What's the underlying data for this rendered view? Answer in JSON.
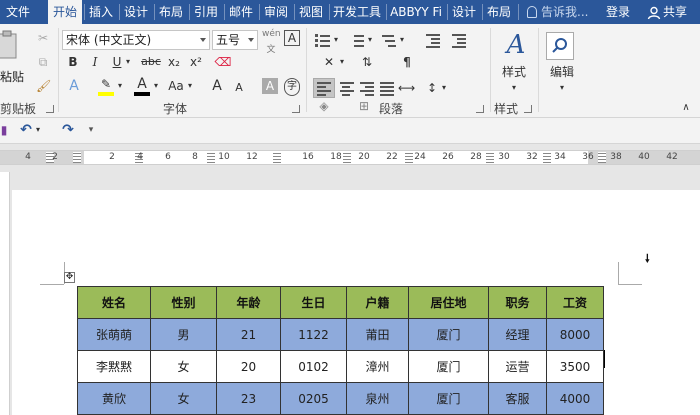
{
  "ribbon_tabs": [
    {
      "label": "文件",
      "active": false
    },
    {
      "label": "开始",
      "active": true
    },
    {
      "label": "插入",
      "active": false
    },
    {
      "label": "设计",
      "active": false
    },
    {
      "label": "布局",
      "active": false
    },
    {
      "label": "引用",
      "active": false
    },
    {
      "label": "邮件",
      "active": false
    },
    {
      "label": "审阅",
      "active": false
    },
    {
      "label": "视图",
      "active": false
    },
    {
      "label": "开发工具",
      "active": false
    },
    {
      "label": "ABBYY Fi",
      "active": false
    },
    {
      "label": "设计",
      "active": false
    },
    {
      "label": "布局",
      "active": false
    }
  ],
  "tell_me": "告诉我...",
  "login": "登录",
  "share": "共享",
  "clipboard": {
    "paste": "粘贴",
    "group": "剪贴板"
  },
  "font": {
    "name": "宋体 (中文正文)",
    "size": "五号",
    "group": "字体",
    "bold": "B",
    "italic": "I",
    "underline": "U",
    "strike": "abc",
    "subscript": "x₂",
    "superscript": "x²",
    "font_color": "A",
    "case": "Aa",
    "grow": "A",
    "shrink": "A",
    "char_shade": "A",
    "char_border": "A",
    "phonetic": "wén",
    "phonetic_char": "文"
  },
  "paragraph": {
    "group": "段落"
  },
  "styles": {
    "label": "样式",
    "group": "样式"
  },
  "editing": {
    "label": "编辑"
  },
  "ruler_numbers": [
    "4",
    "2",
    "2",
    "4",
    "6",
    "8",
    "10",
    "12",
    "16",
    "18",
    "20",
    "22",
    "24",
    "26",
    "28",
    "30",
    "32",
    "34",
    "36",
    "38",
    "40",
    "42"
  ],
  "table": {
    "headers": [
      "姓名",
      "性别",
      "年龄",
      "生日",
      "户籍",
      "居住地",
      "职务",
      "工资"
    ],
    "rows": [
      [
        "张萌萌",
        "男",
        "21",
        "1122",
        "莆田",
        "厦门",
        "经理",
        "8000"
      ],
      [
        "李黙黙",
        "女",
        "20",
        "0102",
        "漳州",
        "厦门",
        "运营",
        "3500"
      ],
      [
        "黄欣",
        "女",
        "23",
        "0205",
        "泉州",
        "厦门",
        "客服",
        "4000"
      ]
    ]
  },
  "colors": {
    "tabbar": "#2b579a",
    "header_row": "#9bbb59",
    "blue_row": "#8eaadb"
  }
}
